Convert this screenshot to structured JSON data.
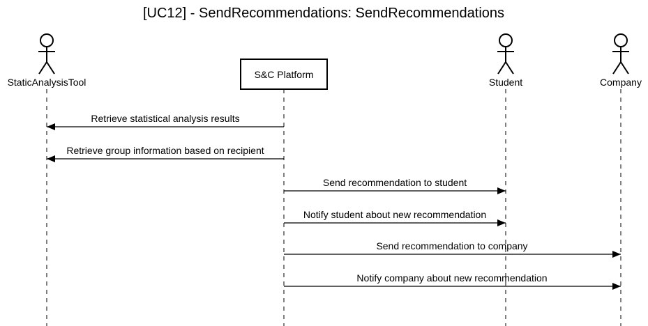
{
  "title": "[UC12] - SendRecommendations: SendRecommendations",
  "participants": [
    {
      "id": "tool",
      "name": "StaticAnalysisTool",
      "kind": "actor"
    },
    {
      "id": "platform",
      "name": "S&C Platform",
      "kind": "box"
    },
    {
      "id": "student",
      "name": "Student",
      "kind": "actor"
    },
    {
      "id": "company",
      "name": "Company",
      "kind": "actor"
    }
  ],
  "messages": [
    {
      "from": "platform",
      "to": "tool",
      "label": "Retrieve statistical analysis results"
    },
    {
      "from": "platform",
      "to": "tool",
      "label": "Retrieve group information based on recipient"
    },
    {
      "from": "platform",
      "to": "student",
      "label": "Send recommendation to student"
    },
    {
      "from": "platform",
      "to": "student",
      "label": "Notify student about new recommendation"
    },
    {
      "from": "platform",
      "to": "company",
      "label": "Send recommendation to company"
    },
    {
      "from": "platform",
      "to": "company",
      "label": "Notify company about new recommendation"
    }
  ]
}
